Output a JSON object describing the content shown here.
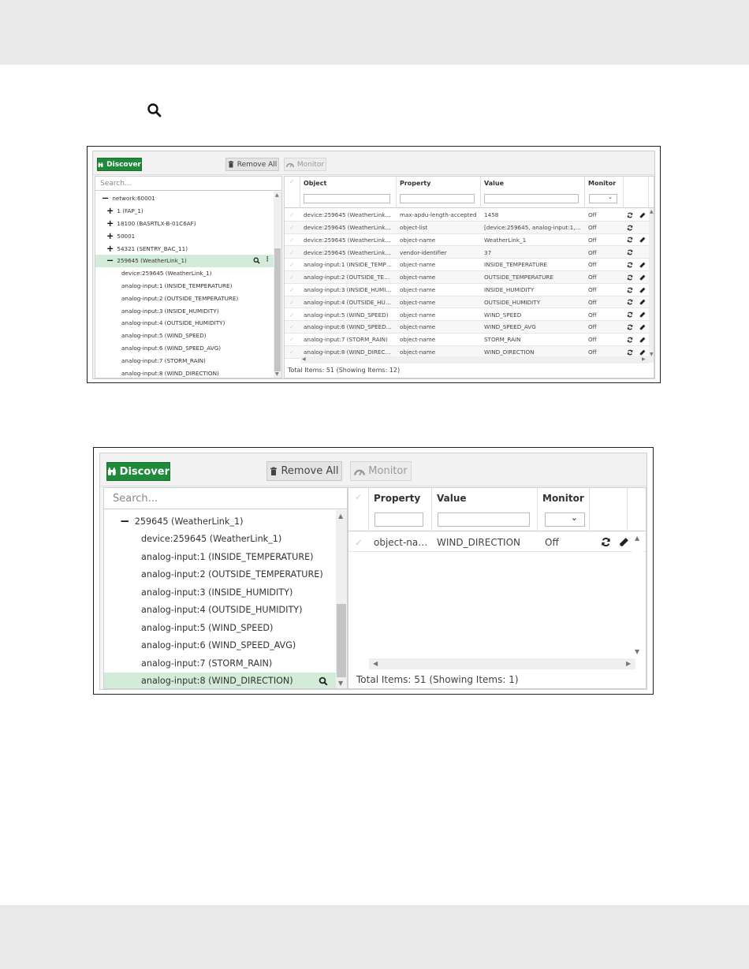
{
  "small": {
    "toolbar": {
      "discover_label": "Discover",
      "remove_all_label": "Remove All",
      "monitor_label": "Monitor"
    },
    "tree": {
      "search_placeholder": "Search...",
      "items": [
        {
          "label": "network:60001",
          "expander": "−"
        },
        {
          "label": "1 (FAP_1)",
          "expander": "+"
        },
        {
          "label": "18100 (BASRTLX-B-01C6AF)",
          "expander": "+"
        },
        {
          "label": "50001",
          "expander": "+"
        },
        {
          "label": "54321 (SENTRY_BAC_11)",
          "expander": "+"
        },
        {
          "label": "259645 (WeatherLink_1)",
          "expander": "−"
        },
        {
          "label": "device:259645 (WeatherLink_1)",
          "expander": ""
        },
        {
          "label": "analog-input:1 (INSIDE_TEMPERATURE)",
          "expander": ""
        },
        {
          "label": "analog-input:2 (OUTSIDE_TEMPERATURE)",
          "expander": ""
        },
        {
          "label": "analog-input:3 (INSIDE_HUMIDITY)",
          "expander": ""
        },
        {
          "label": "analog-input:4 (OUTSIDE_HUMIDITY)",
          "expander": ""
        },
        {
          "label": "analog-input:5 (WIND_SPEED)",
          "expander": ""
        },
        {
          "label": "analog-input:6 (WIND_SPEED_AVG)",
          "expander": ""
        },
        {
          "label": "analog-input:7 (STORM_RAIN)",
          "expander": ""
        },
        {
          "label": "analog-input:8 (WIND_DIRECTION)",
          "expander": ""
        }
      ]
    },
    "grid": {
      "headers": [
        "Object",
        "Property",
        "Value",
        "Monitor"
      ],
      "rows": [
        {
          "object": "device:259645 (WeatherLink_1)",
          "property": "max-apdu-length-accepted",
          "value": "1458",
          "monitor": "Off"
        },
        {
          "object": "device:259645 (WeatherLink_1)",
          "property": "object-list",
          "value": "[device:259645, analog-input:1, an...",
          "monitor": "Off"
        },
        {
          "object": "device:259645 (WeatherLink_1)",
          "property": "object-name",
          "value": "WeatherLink_1",
          "monitor": "Off"
        },
        {
          "object": "device:259645 (WeatherLink_1)",
          "property": "vendor-identifier",
          "value": "37",
          "monitor": "Off"
        },
        {
          "object": "analog-input:1 (INSIDE_TEMPE...",
          "property": "object-name",
          "value": "INSIDE_TEMPERATURE",
          "monitor": "Off"
        },
        {
          "object": "analog-input:2 (OUTSIDE_TEM...",
          "property": "object-name",
          "value": "OUTSIDE_TEMPERATURE",
          "monitor": "Off"
        },
        {
          "object": "analog-input:3 (INSIDE_HUMIDI...",
          "property": "object-name",
          "value": "INSIDE_HUMIDITY",
          "monitor": "Off"
        },
        {
          "object": "analog-input:4 (OUTSIDE_HUMI...",
          "property": "object-name",
          "value": "OUTSIDE_HUMIDITY",
          "monitor": "Off"
        },
        {
          "object": "analog-input:5 (WIND_SPEED)",
          "property": "object-name",
          "value": "WIND_SPEED",
          "monitor": "Off"
        },
        {
          "object": "analog-input:6 (WIND_SPEED_A...",
          "property": "object-name",
          "value": "WIND_SPEED_AVG",
          "monitor": "Off"
        },
        {
          "object": "analog-input:7 (STORM_RAIN)",
          "property": "object-name",
          "value": "STORM_RAIN",
          "monitor": "Off"
        },
        {
          "object": "analog-input:8 (WIND_DIRECTI...",
          "property": "object-name",
          "value": "WIND_DIRECTION",
          "monitor": "Off"
        }
      ],
      "footer": "Total Items: 51 (Showing Items: 12)"
    }
  },
  "large": {
    "toolbar": {
      "discover_label": "Discover",
      "remove_all_label": "Remove All",
      "monitor_label": "Monitor"
    },
    "tree": {
      "search_placeholder": "Search...",
      "items": [
        {
          "label": "259645 (WeatherLink_1)",
          "expander": "−"
        },
        {
          "label": "device:259645 (WeatherLink_1)",
          "expander": ""
        },
        {
          "label": "analog-input:1 (INSIDE_TEMPERATURE)",
          "expander": ""
        },
        {
          "label": "analog-input:2 (OUTSIDE_TEMPERATURE)",
          "expander": ""
        },
        {
          "label": "analog-input:3 (INSIDE_HUMIDITY)",
          "expander": ""
        },
        {
          "label": "analog-input:4 (OUTSIDE_HUMIDITY)",
          "expander": ""
        },
        {
          "label": "analog-input:5 (WIND_SPEED)",
          "expander": ""
        },
        {
          "label": "analog-input:6 (WIND_SPEED_AVG)",
          "expander": ""
        },
        {
          "label": "analog-input:7 (STORM_RAIN)",
          "expander": ""
        },
        {
          "label": "analog-input:8 (WIND_DIRECTION)",
          "expander": ""
        }
      ]
    },
    "grid": {
      "headers": [
        "Property",
        "Value",
        "Monitor"
      ],
      "rows": [
        {
          "property": "object-name",
          "value": "WIND_DIRECTION",
          "monitor": "Off"
        }
      ],
      "footer": "Total Items: 51 (Showing Items: 1)"
    }
  },
  "icons": {
    "discover": "binoculars-icon",
    "remove_all": "trash-icon",
    "monitor": "gauge-icon",
    "refresh": "refresh-icon",
    "edit": "pencil-icon",
    "search": "search-icon"
  },
  "colors": {
    "discover_green": "#1e8a3a",
    "selected_row": "#d3ebd9"
  }
}
